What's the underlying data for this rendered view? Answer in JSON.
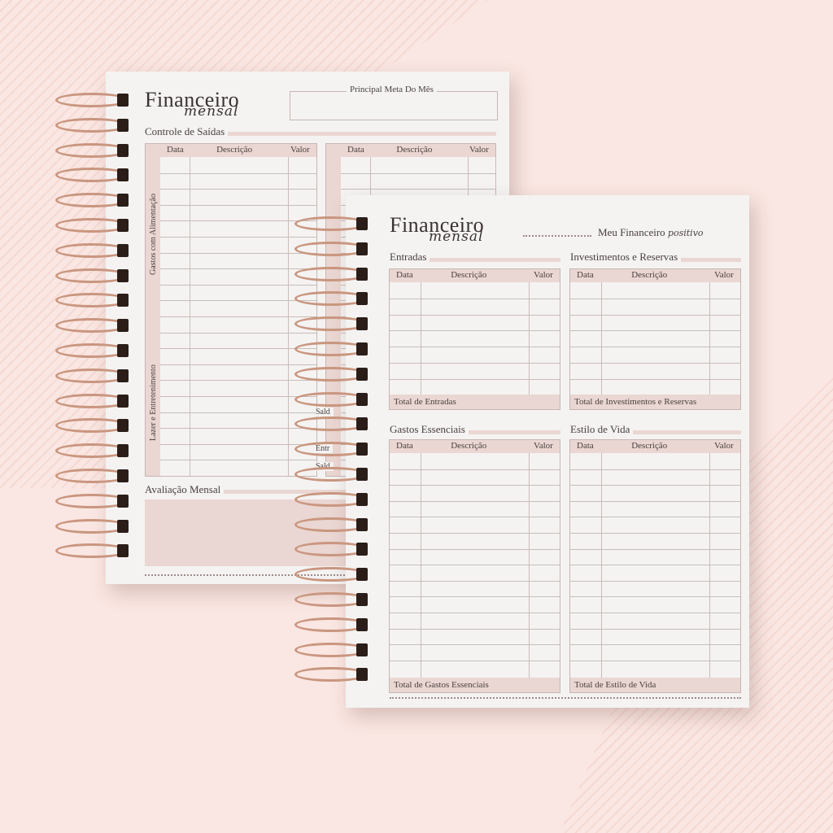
{
  "brand": {
    "title": "Financeiro",
    "subtitle": "mensal"
  },
  "back_page": {
    "goal_label": "Principal Meta Do Mês",
    "controle": "Controle de Saídas",
    "headers": [
      "Data",
      "Descrição",
      "Valor"
    ],
    "side_food": "Gastos com Alimentação",
    "side_leisure": "Lazer e Entretenimento",
    "avaliacao": "Avaliação Mensal",
    "peek": [
      "Sald",
      "Entr",
      "Sald"
    ]
  },
  "front_page": {
    "tagline": "Meu Financeiro",
    "tagline_script": "positivo",
    "headers": [
      "Data",
      "Descrição",
      "Valor"
    ],
    "sections": {
      "entradas": {
        "title": "Entradas",
        "total": "Total de Entradas"
      },
      "investimentos": {
        "title": "Investimentos e Reservas",
        "total": "Total de Investimentos e Reservas"
      },
      "essenciais": {
        "title": "Gastos Essenciais",
        "total": "Total de Gastos Essenciais"
      },
      "estilo": {
        "title": "Estilo de Vida",
        "total": "Total de Estilo de Vida"
      }
    }
  },
  "colors": {
    "background": "#fae6e2",
    "accent": "#ead6d2",
    "coil": "#c9967f",
    "paper": "#f4f3f2"
  }
}
